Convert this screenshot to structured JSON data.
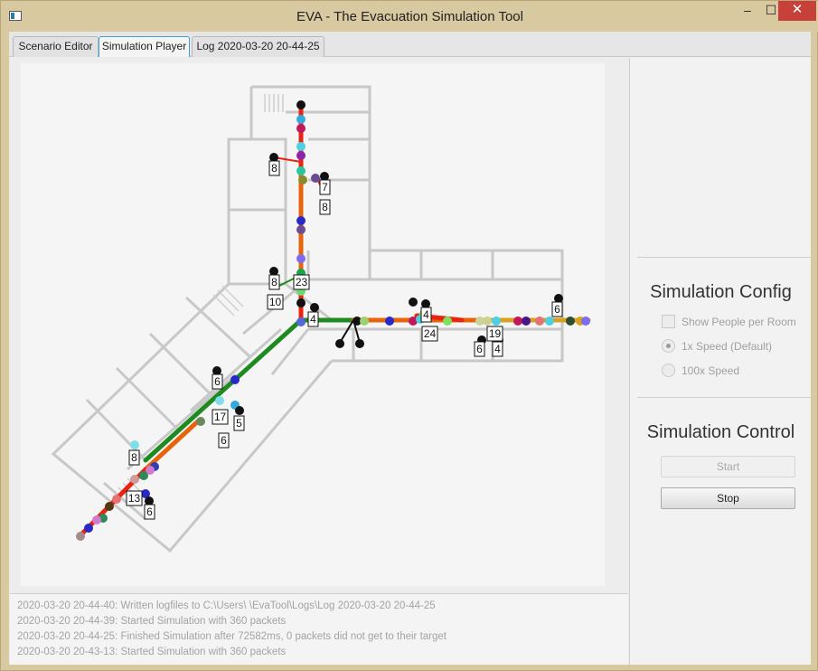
{
  "window": {
    "title": "EVA - The Evacuation Simulation Tool",
    "controls": {
      "minimize": "–",
      "maximize": "☐",
      "close": "✕"
    }
  },
  "tabs": [
    {
      "label": "Scenario Editor",
      "active": false
    },
    {
      "label": "Simulation Player",
      "active": true
    },
    {
      "label": "Log 2020-03-20 20-44-25",
      "active": false
    }
  ],
  "floorplan": {
    "room_counts": [
      "8",
      "7",
      "8",
      "8",
      "23",
      "10",
      "4",
      "4",
      "24",
      "19",
      "6",
      "4",
      "6",
      "6",
      "17",
      "5",
      "6",
      "8",
      "13",
      "6"
    ],
    "path_colors": {
      "red": "#e8230f",
      "orange": "#e8640c",
      "green": "#1f8a1f",
      "amber": "#d9a21e"
    }
  },
  "simulation_config": {
    "title": "Simulation Config",
    "show_people": {
      "label": "Show People per Room",
      "checked": false
    },
    "speed_1x": {
      "label": "1x Speed (Default)",
      "selected": true
    },
    "speed_100x": {
      "label": "100x Speed",
      "selected": false
    }
  },
  "simulation_control": {
    "title": "Simulation Control",
    "start_label": "Start",
    "stop_label": "Stop"
  },
  "log": [
    "2020-03-20 20-44-40: Written logfiles to C:\\Users\\                    \\EvaTool\\Logs\\Log 2020-03-20 20-44-25",
    "2020-03-20 20-44-39: Started Simulation with 360 packets",
    "2020-03-20 20-44-25: Finished Simulation after 72582ms, 0 packets did not get to their target",
    "2020-03-20 20-43-13: Started Simulation with 360 packets"
  ]
}
